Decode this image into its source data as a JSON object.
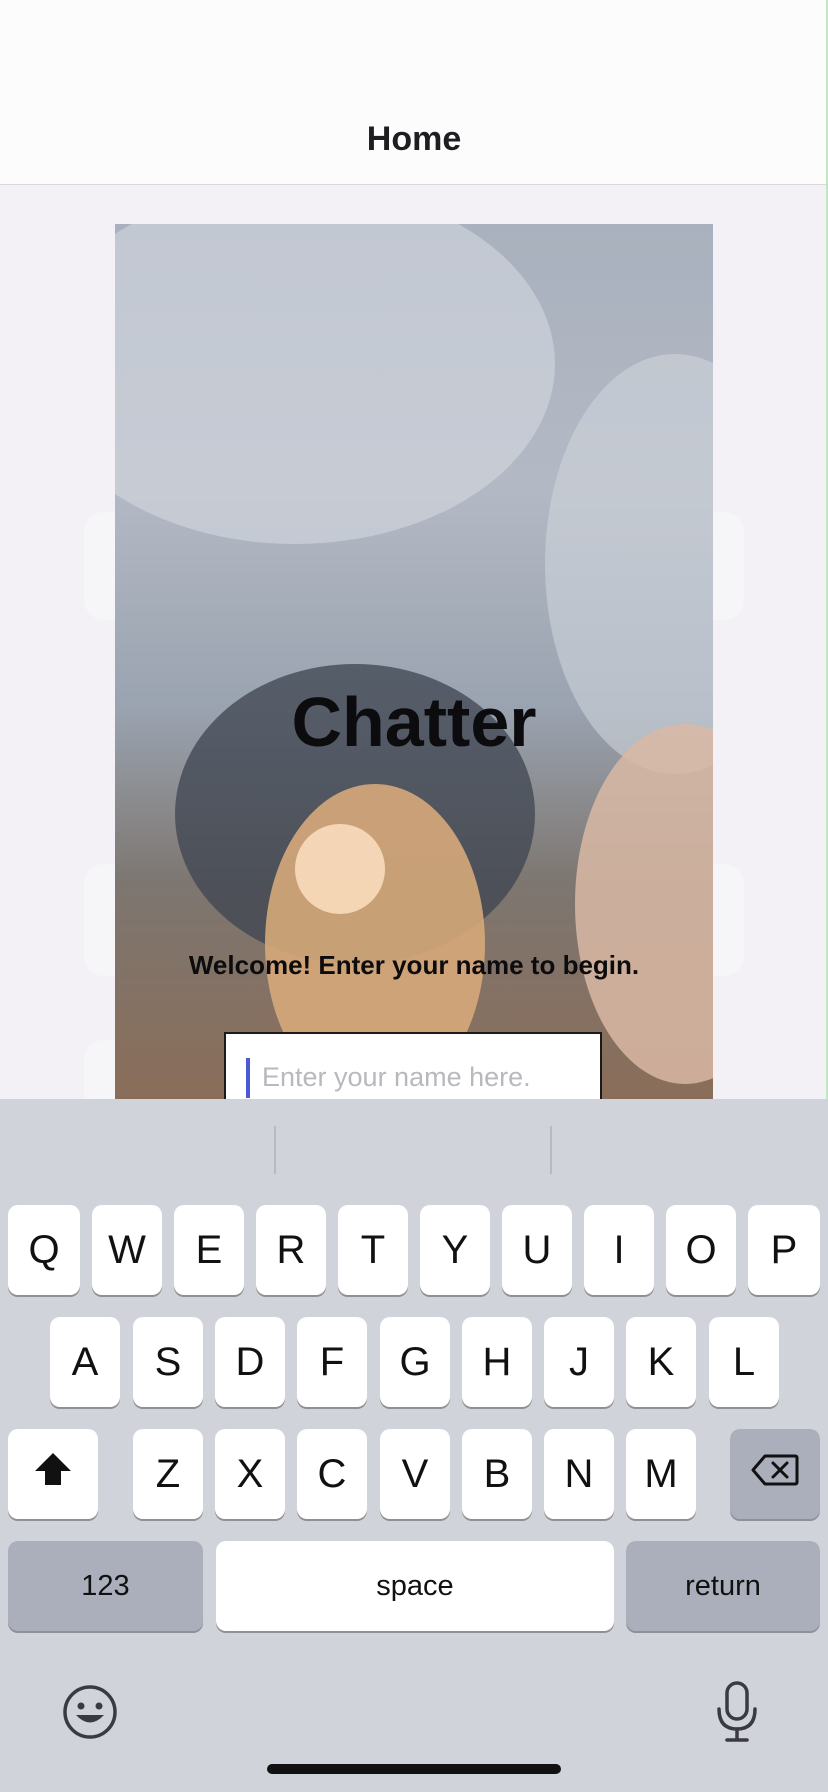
{
  "nav": {
    "title": "Home"
  },
  "hero": {
    "title": "Chatter",
    "welcome": "Welcome! Enter your name to begin."
  },
  "name_input": {
    "placeholder": "Enter your name here.",
    "value": ""
  },
  "keyboard": {
    "row1": [
      "Q",
      "W",
      "E",
      "R",
      "T",
      "Y",
      "U",
      "I",
      "O",
      "P"
    ],
    "row2": [
      "A",
      "S",
      "D",
      "F",
      "G",
      "H",
      "J",
      "K",
      "L"
    ],
    "row3": [
      "Z",
      "X",
      "C",
      "V",
      "B",
      "N",
      "M"
    ],
    "numbers_label": "123",
    "space_label": "space",
    "return_label": "return",
    "icons": {
      "shift": "shift-icon",
      "delete": "delete-icon",
      "emoji": "emoji-icon",
      "dictation": "microphone-icon"
    }
  },
  "colors": {
    "caret": "#4a5ad6",
    "keyboard_bg": "#d1d3da",
    "key_bg": "#ffffff",
    "key_dark_bg": "#abafbc"
  }
}
